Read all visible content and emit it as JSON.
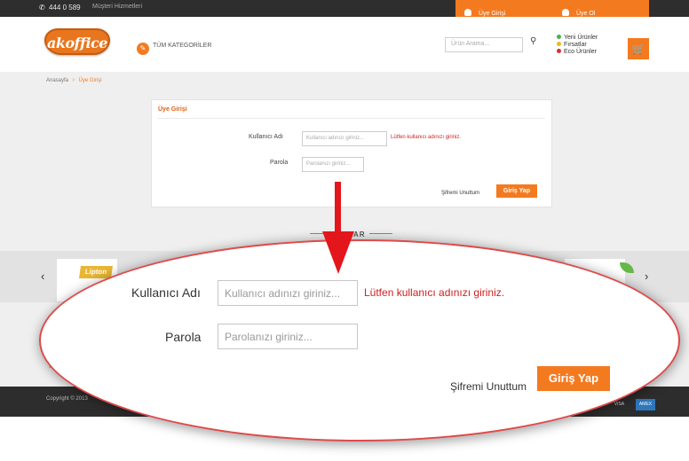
{
  "topbar": {
    "phone": "444 0 589",
    "service": "Müşteri Hizmetleri",
    "login": "Üye Girişi",
    "register": "Üye Ol"
  },
  "header": {
    "logo_text": "akoffice",
    "categories": "TÜM KATEGORİLER",
    "search_placeholder": "Ürün Arama...",
    "links": [
      "Yeni Ürünler",
      "Fırsatlar",
      "Eco Ürünler"
    ]
  },
  "breadcrumb": {
    "home": "Anasayfa",
    "separator": ">",
    "current": "Üye Girişi"
  },
  "login_form": {
    "title": "Üye Girişi",
    "username_label": "Kullanıcı Adı",
    "username_placeholder": "Kullanıcı adınızı giriniz...",
    "username_error": "Lütfen kullanıcı adınızı giriniz.",
    "password_label": "Parola",
    "password_placeholder": "Parolanızı giriniz...",
    "forgot": "Şifremi Unuttum",
    "submit": "Giriş Yap"
  },
  "brands": {
    "title": "KALAR",
    "lipton": "Lipton",
    "prev": "‹",
    "next": "›"
  },
  "footer": {
    "copyright": "Copyright © 2013",
    "letter": "T",
    "cards": [
      "VISA",
      "AMEX"
    ]
  },
  "colors": {
    "accent": "#f47a20",
    "error": "#d01f1f",
    "dark": "#2e2e2e"
  }
}
